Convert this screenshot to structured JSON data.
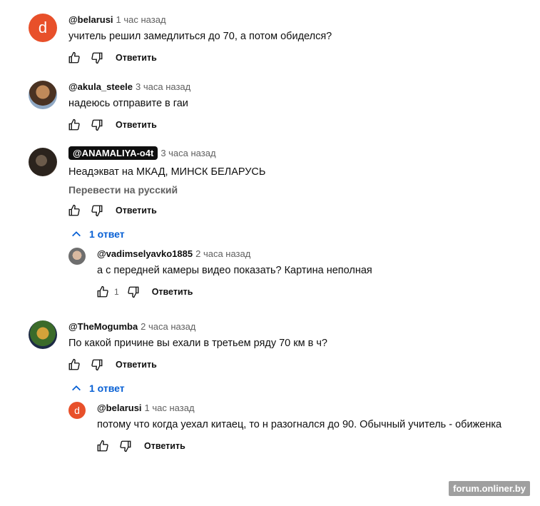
{
  "threads": [
    {
      "avatar_letter": "d",
      "author": "@belarusi",
      "time": "1 час назад",
      "text": "учитель решил замедлиться до 70, а потом обиделся?",
      "reply_label": "Ответить"
    },
    {
      "author": "@akula_steele",
      "time": "3 часа назад",
      "text": "надеюсь отправите в гаи",
      "reply_label": "Ответить"
    },
    {
      "author": "@ANAMALIYA-o4t",
      "time": "3 часа назад",
      "text": "Неадэкват на МКАД, МИНСК БЕЛАРУСЬ",
      "translate": "Перевести на русский",
      "reply_label": "Ответить",
      "replies_toggle": "1 ответ",
      "reply": {
        "author": "@vadimselyavko1885",
        "time": "2 часа назад",
        "text": "а с передней камеры видео показать? Картина неполная",
        "likes": "1",
        "reply_label": "Ответить"
      }
    },
    {
      "author": "@TheMogumba",
      "time": "2 часа назад",
      "text": "По какой причине вы ехали в третьем ряду 70 км в ч?",
      "reply_label": "Ответить",
      "replies_toggle": "1 ответ",
      "reply": {
        "avatar_letter": "d",
        "author": "@belarusi",
        "time": "1 час назад",
        "text": "потому что когда уехал китаец, то н разогнался до 90. Обычный учитель - обиженка",
        "reply_label": "Ответить"
      }
    }
  ],
  "watermark": "forum.onliner.by",
  "colors": {
    "link_blue": "#065fd4",
    "avatar_orange": "#e8502a",
    "meta_gray": "#606060"
  },
  "icons": [
    "like-icon",
    "dislike-icon",
    "chevron-up-icon"
  ]
}
